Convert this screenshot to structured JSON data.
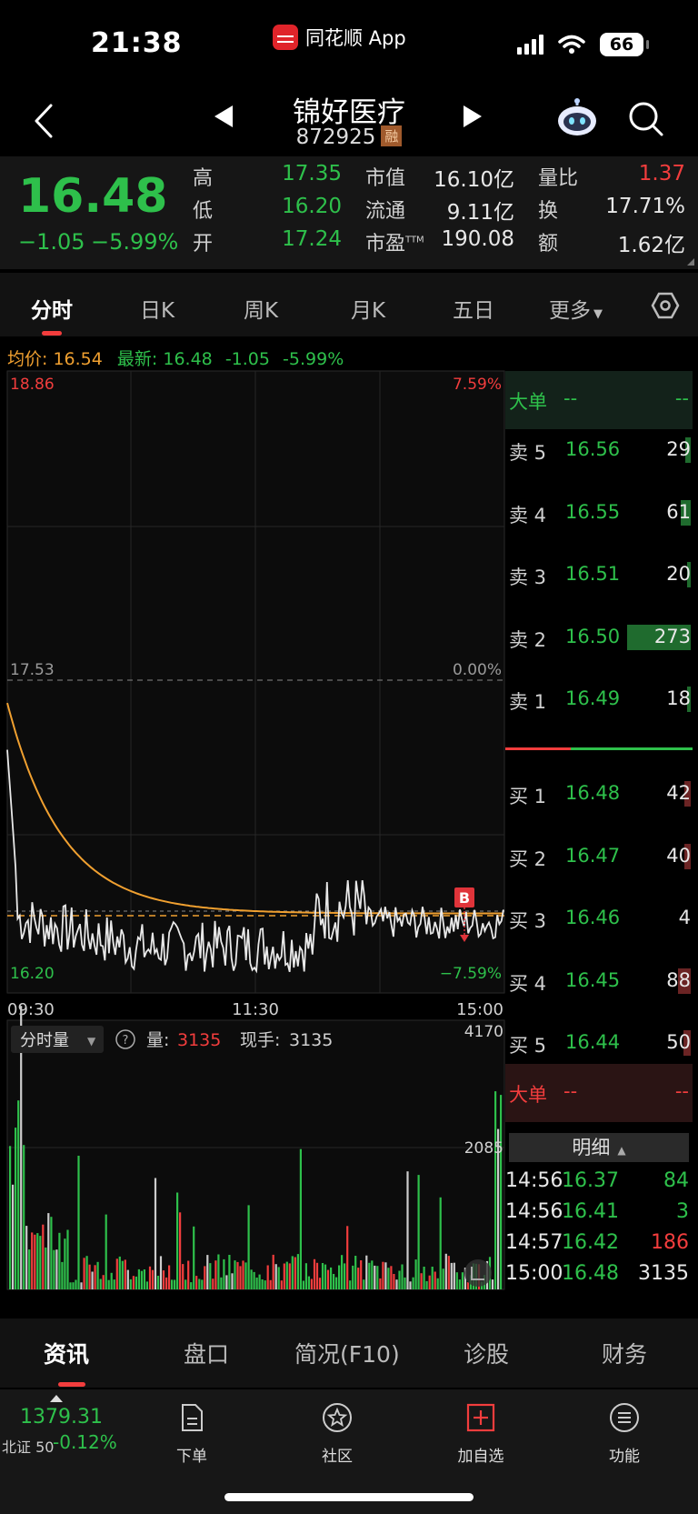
{
  "status_bar": {
    "time": "21:38",
    "app_name": "同花顺 App",
    "battery": "66"
  },
  "header": {
    "stock_name": "锦好医疗",
    "stock_code": "872925",
    "margin_tag": "融"
  },
  "quote": {
    "price": "16.48",
    "change": "−1.05",
    "change_pct": "−5.99%",
    "high_label": "高",
    "high": "17.35",
    "low_label": "低",
    "low": "16.20",
    "open_label": "开",
    "open": "17.24",
    "mktcap_label": "市值",
    "mktcap": "16.10亿",
    "float_label": "流通",
    "float": "9.11亿",
    "pe_label": "市盈",
    "pe_sup": "TTM",
    "pe": "190.08",
    "vratio_label": "量比",
    "vratio": "1.37",
    "turnover_label": "换",
    "turnover": "17.71%",
    "amount_label": "额",
    "amount": "1.62亿"
  },
  "period_tabs": [
    "分时",
    "日K",
    "周K",
    "月K",
    "五日",
    "更多"
  ],
  "avg_line": {
    "avg_label": "均价:",
    "avg": "16.54",
    "latest_label": "最新:",
    "latest": "16.48",
    "chg": "-1.05",
    "pct": "-5.99%"
  },
  "chart": {
    "y_top": "18.86",
    "y_mid": "17.53",
    "y_bot": "16.20",
    "pct_top": "7.59%",
    "pct_mid": "0.00%",
    "pct_bot": "−7.59%",
    "x_start": "09:30",
    "x_mid": "11:30",
    "x_end": "15:00",
    "marker": "B",
    "vol_selector": "分时量",
    "vol_label": "量:",
    "vol_value": "3135",
    "now_label": "现手:",
    "now_value": "3135",
    "vol_max": "4170",
    "vol_mid": "2085"
  },
  "order_book": {
    "big_label": "大单",
    "big_a": "--",
    "big_b": "--",
    "asks": [
      {
        "label": "卖 5",
        "price": "16.56",
        "vol": "29",
        "fill": 0.08
      },
      {
        "label": "卖 4",
        "price": "16.55",
        "vol": "61",
        "fill": 0.15
      },
      {
        "label": "卖 3",
        "price": "16.51",
        "vol": "20",
        "fill": 0.06
      },
      {
        "label": "卖 2",
        "price": "16.50",
        "vol": "273",
        "fill": 1.0
      },
      {
        "label": "卖 1",
        "price": "16.49",
        "vol": "18",
        "fill": 0.05
      }
    ],
    "bids": [
      {
        "label": "买 1",
        "price": "16.48",
        "vol": "42",
        "fill": 0.1
      },
      {
        "label": "买 2",
        "price": "16.47",
        "vol": "40",
        "fill": 0.1
      },
      {
        "label": "买 3",
        "price": "16.46",
        "vol": "4",
        "fill": 0.0
      },
      {
        "label": "买 4",
        "price": "16.45",
        "vol": "88",
        "fill": 0.2
      },
      {
        "label": "买 5",
        "price": "16.44",
        "vol": "50",
        "fill": 0.12
      }
    ],
    "big2_label": "大单",
    "big2_a": "--",
    "big2_b": "--",
    "detail_label": "明细",
    "details": [
      {
        "time": "14:56",
        "price": "16.37",
        "vol": "84",
        "vol_color": "#2ec04b"
      },
      {
        "time": "14:56",
        "price": "16.41",
        "vol": "3",
        "vol_color": "#2ec04b"
      },
      {
        "time": "14:57",
        "price": "16.42",
        "vol": "186",
        "vol_color": "#f23d3d"
      },
      {
        "time": "15:00",
        "price": "16.48",
        "vol": "3135",
        "vol_color": "#e8e8e8"
      }
    ]
  },
  "info_tabs": [
    "资讯",
    "盘口",
    "简况(F10)",
    "诊股",
    "财务"
  ],
  "toolbar": {
    "index_value": "1379.31",
    "index_name": "北证 50",
    "index_pct": "-0.12%",
    "order": "下单",
    "community": "社区",
    "watch": "加自选",
    "functions": "功能"
  },
  "colors": {
    "up": "#f23d3d",
    "down": "#2ec04b",
    "avg_line": "#f0a030",
    "price_line": "#e8e8e8",
    "bg": "#000000"
  }
}
